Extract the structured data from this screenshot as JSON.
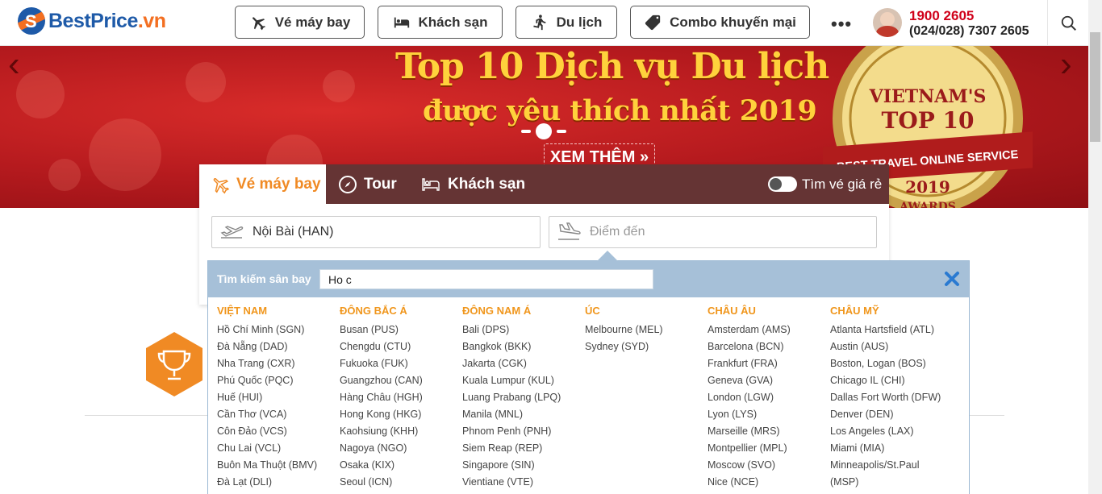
{
  "header": {
    "logo": {
      "brand": "BestPrice",
      "tld": ".vn"
    },
    "nav": [
      {
        "label": "Vé máy bay",
        "icon": "plane-icon"
      },
      {
        "label": "Khách sạn",
        "icon": "bed-icon"
      },
      {
        "label": "Du lịch",
        "icon": "walker-icon"
      },
      {
        "label": "Combo khuyến mại",
        "icon": "tag-icon"
      }
    ],
    "more": "•••",
    "hotline": "1900 2605",
    "phone": "(024/028) 7307 2605"
  },
  "banner": {
    "title_line1": "Top 10 Dịch vụ Du lịch",
    "title_line2": "được yêu thích nhất 2019",
    "cta": "XEM THÊM »",
    "medal": {
      "line1": "VIETNAM'S",
      "line2": "TOP 10",
      "ribbon": "BEST TRAVEL ONLINE SERVICE",
      "year": "2019",
      "awards": "AWARDS"
    }
  },
  "search": {
    "tabs": [
      {
        "label": "Vé máy bay",
        "active": true
      },
      {
        "label": "Tour",
        "active": false
      },
      {
        "label": "Khách sạn",
        "active": false
      }
    ],
    "toggle_label": "Tìm vé giá rẻ",
    "from_value": "Nội Bài (HAN)",
    "to_placeholder": "Điểm đến"
  },
  "airport_dropdown": {
    "label": "Tìm kiếm sân bay",
    "query": "Ho c",
    "columns": [
      {
        "title": "VIỆT NAM",
        "items": [
          "Hồ Chí Minh (SGN)",
          "Đà Nẵng (DAD)",
          "Nha Trang (CXR)",
          "Phú Quốc (PQC)",
          "Huế (HUI)",
          "Cần Thơ (VCA)",
          "Côn Đảo (VCS)",
          "Chu Lai (VCL)",
          "Buôn Ma Thuột (BMV)",
          "Đà Lạt (DLI)"
        ]
      },
      {
        "title": "ĐÔNG BẮC Á",
        "items": [
          "Busan (PUS)",
          "Chengdu (CTU)",
          "Fukuoka (FUK)",
          "Guangzhou (CAN)",
          "Hàng Châu (HGH)",
          "Hong Kong (HKG)",
          "Kaohsiung (KHH)",
          "Nagoya (NGO)",
          "Osaka (KIX)",
          "Seoul (ICN)"
        ]
      },
      {
        "title": "ĐÔNG NAM Á",
        "items": [
          "Bali (DPS)",
          "Bangkok (BKK)",
          "Jakarta (CGK)",
          "Kuala Lumpur (KUL)",
          "Luang Prabang (LPQ)",
          "Manila (MNL)",
          "Phnom Penh (PNH)",
          "Siem Reap (REP)",
          "Singapore (SIN)",
          "Vientiane (VTE)"
        ]
      },
      {
        "title": "ÚC",
        "items": [
          "Melbourne (MEL)",
          "Sydney (SYD)"
        ]
      },
      {
        "title": "CHÂU ÂU",
        "items": [
          "Amsterdam (AMS)",
          "Barcelona (BCN)",
          "Frankfurt (FRA)",
          "Geneva (GVA)",
          "London (LGW)",
          "Lyon (LYS)",
          "Marseille (MRS)",
          "Montpellier (MPL)",
          "Moscow (SVO)",
          "Nice (NCE)"
        ]
      },
      {
        "title": "CHÂU MỸ",
        "items": [
          "Atlanta Hartsfield (ATL)",
          "Austin (AUS)",
          "Boston, Logan (BOS)",
          "Chicago IL (CHI)",
          "Dallas Fort Worth (DFW)",
          "Denver (DEN)",
          "Los Angeles (LAX)",
          "Miami (MIA)",
          "Minneapolis/St.Paul",
          "(MSP)"
        ]
      }
    ]
  },
  "colors": {
    "brand_blue": "#1e5aa8",
    "brand_orange": "#f36f21",
    "accent_orange": "#f08a24",
    "banner_red": "#c0201f",
    "dropdown_blue": "#a6c0d8"
  }
}
